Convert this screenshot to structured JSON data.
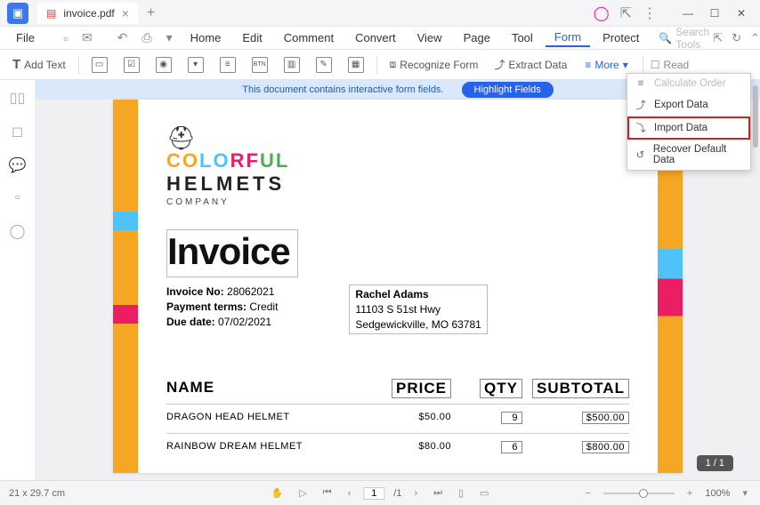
{
  "tab": {
    "title": "invoice.pdf"
  },
  "menu": {
    "file": "File",
    "items": [
      "Home",
      "Edit",
      "Comment",
      "Convert",
      "View",
      "Page",
      "Tool",
      "Form",
      "Protect"
    ],
    "active": "Form",
    "search_placeholder": "Search Tools"
  },
  "toolbar": {
    "add_text": "Add Text",
    "recognize": "Recognize Form",
    "extract": "Extract Data",
    "more": "More",
    "read": "Read"
  },
  "banner": {
    "msg": "This document contains interactive form fields.",
    "btn": "Highlight Fields"
  },
  "dropdown": {
    "calculate": "Calculate Order",
    "export": "Export Data",
    "import": "Import Data",
    "recover": "Recover Default Data"
  },
  "doc": {
    "brand1": "COLORFUL",
    "brand2": "HELMETS",
    "brand3": "COMPANY",
    "title": "Invoice",
    "invoice_no_label": "Invoice No:",
    "invoice_no": "28062021",
    "payment_label": "Payment terms:",
    "payment": "Credit",
    "due_label": "Due date:",
    "due": "07/02/2021",
    "client_name": "Rachel Adams",
    "client_addr1": "11103 S 51st Hwy",
    "client_addr2": "Sedgewickville, MO 63781",
    "col_name": "NAME",
    "col_price": "PRICE",
    "col_qty": "QTY",
    "col_sub": "SUBTOTAL",
    "rows": [
      {
        "name": "DRAGON HEAD HELMET",
        "price": "$50.00",
        "qty": "9",
        "sub": "$500.00"
      },
      {
        "name": "RAINBOW DREAM HELMET",
        "price": "$80.00",
        "qty": "6",
        "sub": "$800.00"
      }
    ]
  },
  "page_badge": "1 / 1",
  "status": {
    "dims": "21 x 29.7 cm",
    "page": "1",
    "page_total": "/1",
    "zoom": "100%"
  }
}
